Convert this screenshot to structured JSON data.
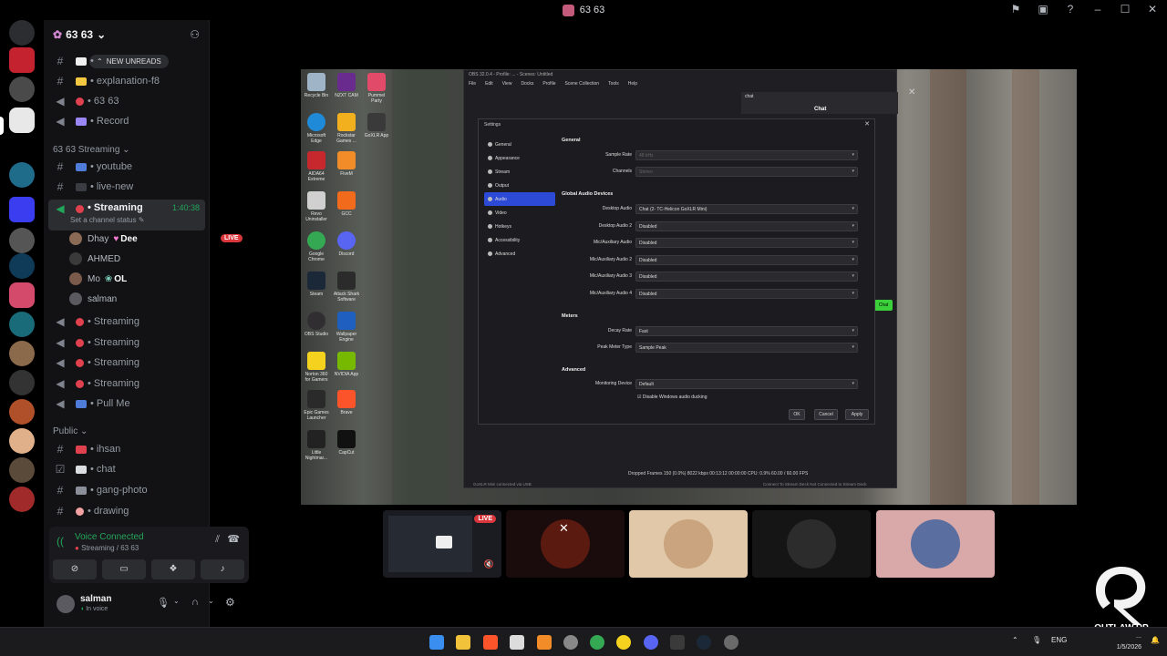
{
  "window": {
    "title": "63 63",
    "controls": [
      "flag-icon",
      "inbox-icon",
      "help-icon",
      "minimize-icon",
      "maximize-icon",
      "close-icon"
    ]
  },
  "server": {
    "name": "63 63",
    "new_unreads": "NEW UNREADS"
  },
  "channels": [
    {
      "type": "text",
      "emoji_color": "#f0f0f0",
      "label": "•"
    },
    {
      "type": "text",
      "emoji_color": "#f5c842",
      "label": "• explanation-f8"
    },
    {
      "type": "voice",
      "emoji_color": "#e0414f",
      "label": "• 63 63"
    },
    {
      "type": "voice",
      "emoji_color": "#9b87f5",
      "label": "• Record"
    }
  ],
  "category_streaming": "63 63 Streaming",
  "streaming_channels": [
    {
      "type": "text",
      "emoji_color": "#4f7bd9",
      "label": "• youtube"
    },
    {
      "type": "text",
      "emoji_color": "#3a3c44",
      "label": "• live-new"
    }
  ],
  "active_voice": {
    "label": "• Streaming",
    "timer": "1:40:38",
    "status": "Set a channel status"
  },
  "voice_users": [
    {
      "name": "Dhay",
      "badge": "Dee",
      "live": "LIVE",
      "avatar_color": "#8a6a55"
    },
    {
      "name": "AHMED",
      "avatar_color": "#3a3a3a"
    },
    {
      "name": "Mo",
      "badge": "OL",
      "avatar_color": "#7a5a4a"
    },
    {
      "name": "salman",
      "avatar_color": "#5a5a60"
    }
  ],
  "more_voice": [
    {
      "label": "• Streaming"
    },
    {
      "label": "• Streaming"
    },
    {
      "label": "• Streaming"
    },
    {
      "label": "• Streaming"
    },
    {
      "label": "• Pull Me"
    }
  ],
  "category_public": "Public",
  "public_channels": [
    {
      "type": "text",
      "emoji_color": "#e0414f",
      "label": "• ihsan"
    },
    {
      "type": "text",
      "emoji_color": "#dbdee1",
      "label": "• chat"
    },
    {
      "type": "text",
      "emoji_color": "#8a8f99",
      "label": "• gang-photo"
    },
    {
      "type": "text",
      "emoji_color": "#f2a2a2",
      "label": "• drawing"
    }
  ],
  "voice_panel": {
    "status": "Voice Connected",
    "channel": "Streaming / 63 63"
  },
  "user_panel": {
    "username": "salman",
    "status": "In voice"
  },
  "desktop_icons": [
    {
      "label": "Recycle Bin",
      "color": "#a0b4c8"
    },
    {
      "label": "NZXT CAM",
      "color": "#6a2b8e"
    },
    {
      "label": "Pummel Party",
      "color": "#e24a6a"
    },
    {
      "label": "Microsoft Edge",
      "color": "#1f8bd8"
    },
    {
      "label": "Rockstar Games ...",
      "color": "#f2b01e"
    },
    {
      "label": "GoXLR App",
      "color": "#3a3a3a"
    },
    {
      "label": "AIDA64 Extreme",
      "color": "#c7282e"
    },
    {
      "label": "FiveM",
      "color": "#f28c28"
    },
    {
      "label": "Revo Uninstaller",
      "color": "#d0d0d0"
    },
    {
      "label": "GCC",
      "color": "#f26a1b"
    },
    {
      "label": "Google Chrome",
      "color": "#34a853"
    },
    {
      "label": "Discord",
      "color": "#5865f2"
    },
    {
      "label": "Steam",
      "color": "#1b2838"
    },
    {
      "label": "Attack Shark Software",
      "color": "#2b2b2b"
    },
    {
      "label": "OBS Studio",
      "color": "#302e31"
    },
    {
      "label": "Wallpaper Engine",
      "color": "#1f5fbf"
    },
    {
      "label": "Norton 360 for Gamers",
      "color": "#f5d21e"
    },
    {
      "label": "NVIDIA App",
      "color": "#76b900"
    },
    {
      "label": "Epic Games Launcher",
      "color": "#2a2a2a"
    },
    {
      "label": "Brave",
      "color": "#fb542b"
    },
    {
      "label": "Little Nightmar...",
      "color": "#222222"
    },
    {
      "label": "CapCut",
      "color": "#111111"
    }
  ],
  "obs": {
    "title": "OBS 32.0.4 - Profile: ... - Scenes: Untitled",
    "menu": [
      "File",
      "Edit",
      "View",
      "Docks",
      "Profile",
      "Scene Collection",
      "Tools",
      "Help"
    ],
    "chat_dock": "chat",
    "chat_title": "Chat",
    "chat_button": "Chat",
    "status": "Dropped Frames 150 (0.0%)    8022 kbps    00:13:12    00:00:00    CPU: 0.9%    60.00 / 60.00 FPS",
    "goxlr": "GoXLR Mini connected via USB",
    "stream_deck": "Connect To Stream Deck      Not Connected to Stream Deck"
  },
  "settings": {
    "title": "Settings",
    "nav": [
      "General",
      "Appearance",
      "Stream",
      "Output",
      "Audio",
      "Video",
      "Hotkeys",
      "Accessibility",
      "Advanced"
    ],
    "selected": "Audio",
    "general_section": "General",
    "sample_rate_label": "Sample Rate",
    "sample_rate_value": "48 kHz",
    "channels_label": "Channels",
    "channels_value": "Stereo",
    "global_section": "Global Audio Devices",
    "devices": [
      {
        "label": "Desktop Audio",
        "value": "Chat (2- TC-Helicon GoXLR Mini)"
      },
      {
        "label": "Desktop Audio 2",
        "value": "Disabled"
      },
      {
        "label": "Mic/Auxiliary Audio",
        "value": "Disabled"
      },
      {
        "label": "Mic/Auxiliary Audio 2",
        "value": "Disabled"
      },
      {
        "label": "Mic/Auxiliary Audio 3",
        "value": "Disabled"
      },
      {
        "label": "Mic/Auxiliary Audio 4",
        "value": "Disabled"
      }
    ],
    "meters_section": "Meters",
    "decay_label": "Decay Rate",
    "decay_value": "Fast",
    "peak_label": "Peak Meter Type",
    "peak_value": "Sample Peak",
    "advanced_section": "Advanced",
    "monitor_label": "Monitoring Device",
    "monitor_value": "Default",
    "ducking": "Disable Windows audio ducking",
    "ok": "OK",
    "cancel": "Cancel",
    "apply": "Apply"
  },
  "tiles": [
    {
      "kind": "screen",
      "live": "LIVE",
      "bg": "#1a1c22"
    },
    {
      "kind": "muted",
      "bg": "#1a0c0c"
    },
    {
      "kind": "avatar",
      "bg": "#e0c8a8",
      "avatar": "#c9a47e"
    },
    {
      "kind": "avatar",
      "bg": "#151515",
      "avatar": "#2c2c2c"
    },
    {
      "kind": "avatar",
      "bg": "#d9a8a8",
      "avatar": "#5a6ea0"
    }
  ],
  "taskbar": {
    "lang": "ENG",
    "time": "...",
    "date": "1/5/2026"
  },
  "watermark": "OUTLAW.RP",
  "colors": {
    "accent": "#5865f2",
    "voice_green": "#23a55a",
    "live_red": "#da373c",
    "obs_selected": "#2c4ad6"
  }
}
